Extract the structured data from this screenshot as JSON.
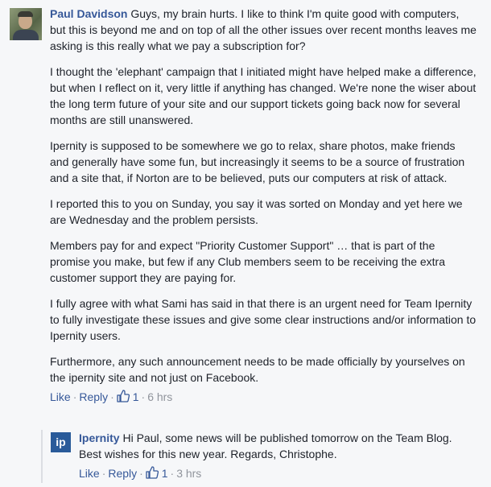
{
  "main_comment": {
    "author": "Paul Davidson",
    "paragraphs": [
      "Guys, my brain hurts. I like to think I'm quite good with computers, but this is beyond me and on top of all the other issues over recent months leaves me asking is this really what we pay a subscription for?",
      "I thought the 'elephant' campaign that I initiated might have helped make a difference, but when I reflect on it, very little if anything has changed. We're none the wiser about the long term future of your site and our support tickets going back now for several months are still unanswered.",
      "Ipernity is supposed to be somewhere we go to relax, share photos, make friends and generally have some fun, but increasingly it seems to be a source of frustration and a site that, if Norton are to be believed, puts our computers at risk of attack.",
      "I reported this to you on Sunday, you say it was sorted on Monday and yet here we are Wednesday and the problem persists.",
      "Members pay for and expect \"Priority Customer Support\" … that is part of the promise you make, but few if any Club members seem to be receiving the extra customer support they are paying for.",
      "I fully agree with what Sami has said in that there is an urgent need for Team Ipernity to fully investigate these issues and give some clear instructions and/or information to Ipernity users.",
      "Furthermore, any such announcement needs to be made officially by yourselves on the ipernity site and not just on Facebook."
    ],
    "like_label": "Like",
    "reply_label": "Reply",
    "like_count": "1",
    "time": "6 hrs"
  },
  "reply": {
    "avatar_text": "ip",
    "author": "Ipernity",
    "text": "Hi Paul, some news will be published tomorrow on the Team Blog. Best wishes for this new year. Regards, Christophe.",
    "like_label": "Like",
    "reply_label": "Reply",
    "like_count": "1",
    "time": "3 hrs"
  },
  "colors": {
    "link": "#365899",
    "meta": "#90949c",
    "text": "#1d2129",
    "background": "#f6f7f9"
  }
}
